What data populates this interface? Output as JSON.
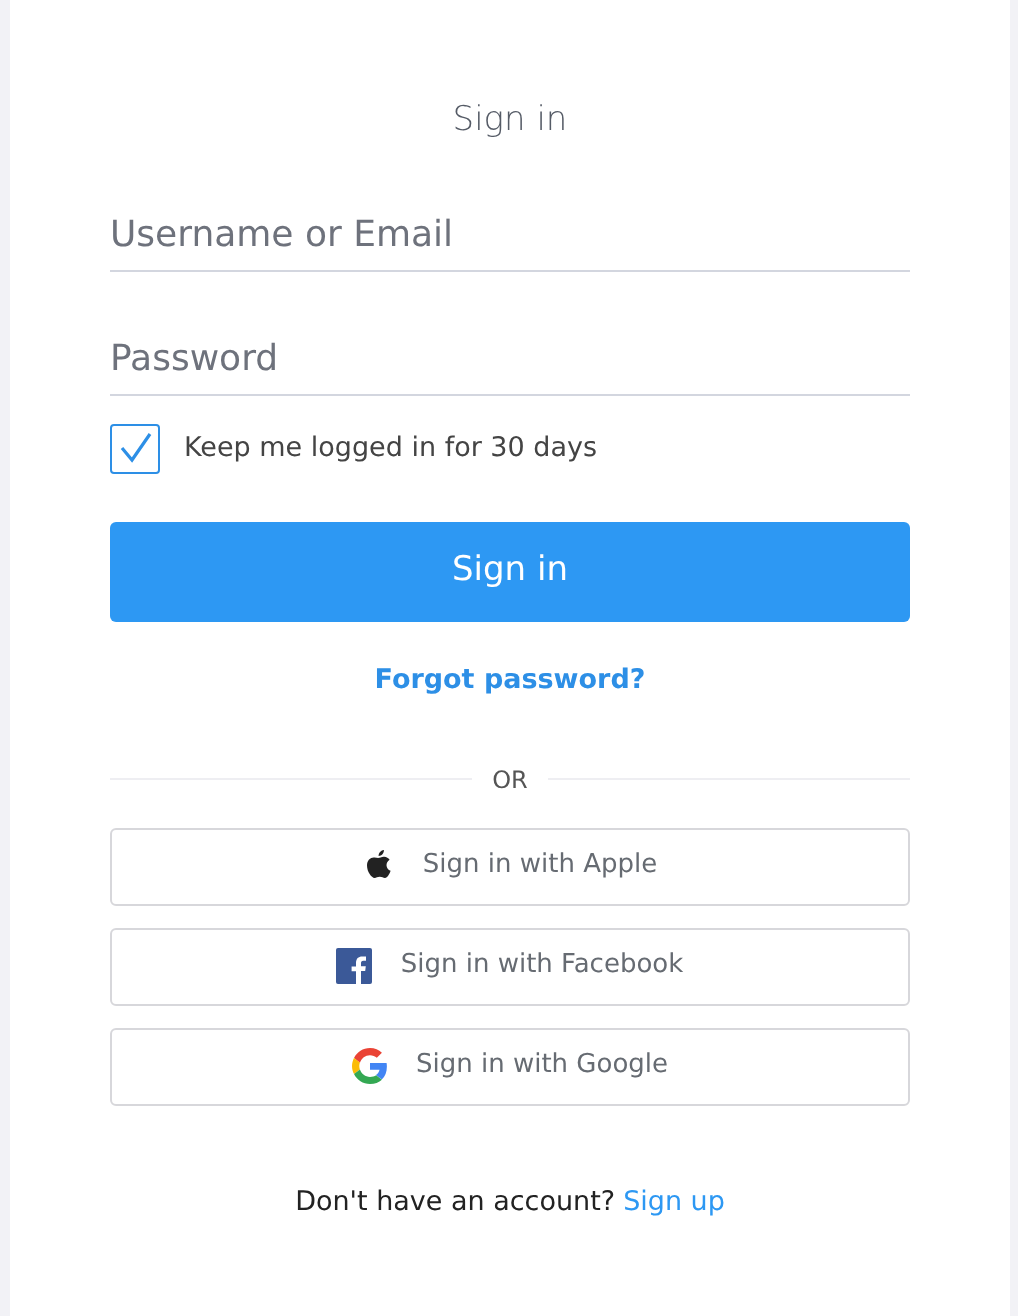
{
  "title": "Sign in",
  "fields": [
    {
      "placeholder": "Username or Email"
    },
    {
      "placeholder": "Password"
    }
  ],
  "remember": {
    "label": "Keep me logged in for 30 days",
    "checked": true
  },
  "submit": "Sign in",
  "forgot": "Forgot password?",
  "divider": "OR",
  "social": [
    {
      "kind": "apple",
      "label": "Sign in with Apple"
    },
    {
      "kind": "facebook",
      "label": "Sign in with Facebook"
    },
    {
      "kind": "google",
      "label": "Sign in with Google"
    }
  ],
  "footer": {
    "text": "Don't have an account?",
    "link": "Sign up"
  }
}
